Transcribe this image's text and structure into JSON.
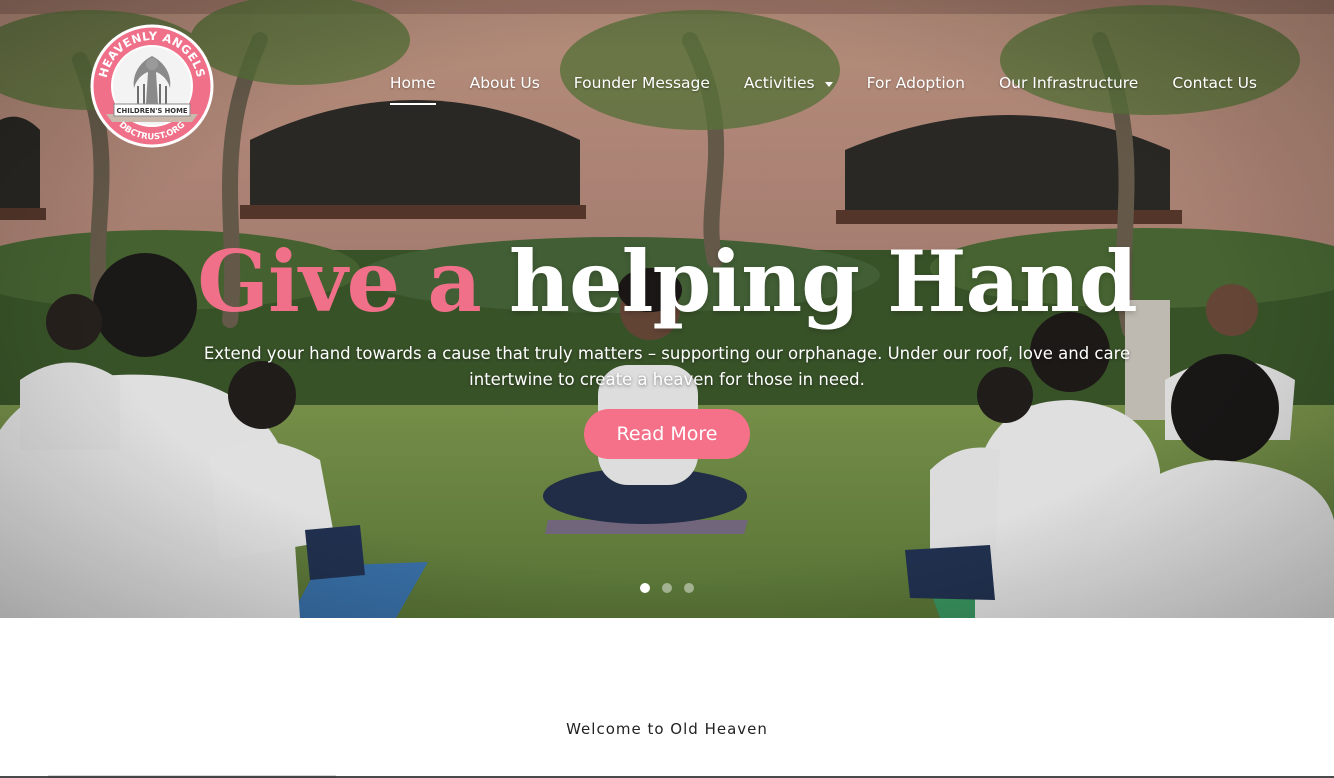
{
  "logo": {
    "top_text": "HEAVENLY ANGELS",
    "ribbon_text": "CHILDREN'S HOME",
    "bottom_text": "DBCTRUST.ORG"
  },
  "nav": {
    "items": [
      {
        "label": "Home",
        "active": true
      },
      {
        "label": "About Us"
      },
      {
        "label": "Founder Message"
      },
      {
        "label": "Activities",
        "has_dropdown": true
      },
      {
        "label": "For Adoption"
      },
      {
        "label": "Our Infrastructure"
      },
      {
        "label": "Contact Us"
      }
    ]
  },
  "hero": {
    "headline_pink": "Give a",
    "headline_white": "helping Hand",
    "subtext": "Extend your hand towards a cause that truly matters – supporting our orphanage. Under our roof, love and care intertwine to create a heaven for those in need.",
    "cta_label": "Read More",
    "slides": 3,
    "active_slide": 1
  },
  "welcome": {
    "text": "Welcome to Old Heaven"
  },
  "colors": {
    "accent": "#f57089",
    "headline_pink": "#f07089"
  }
}
